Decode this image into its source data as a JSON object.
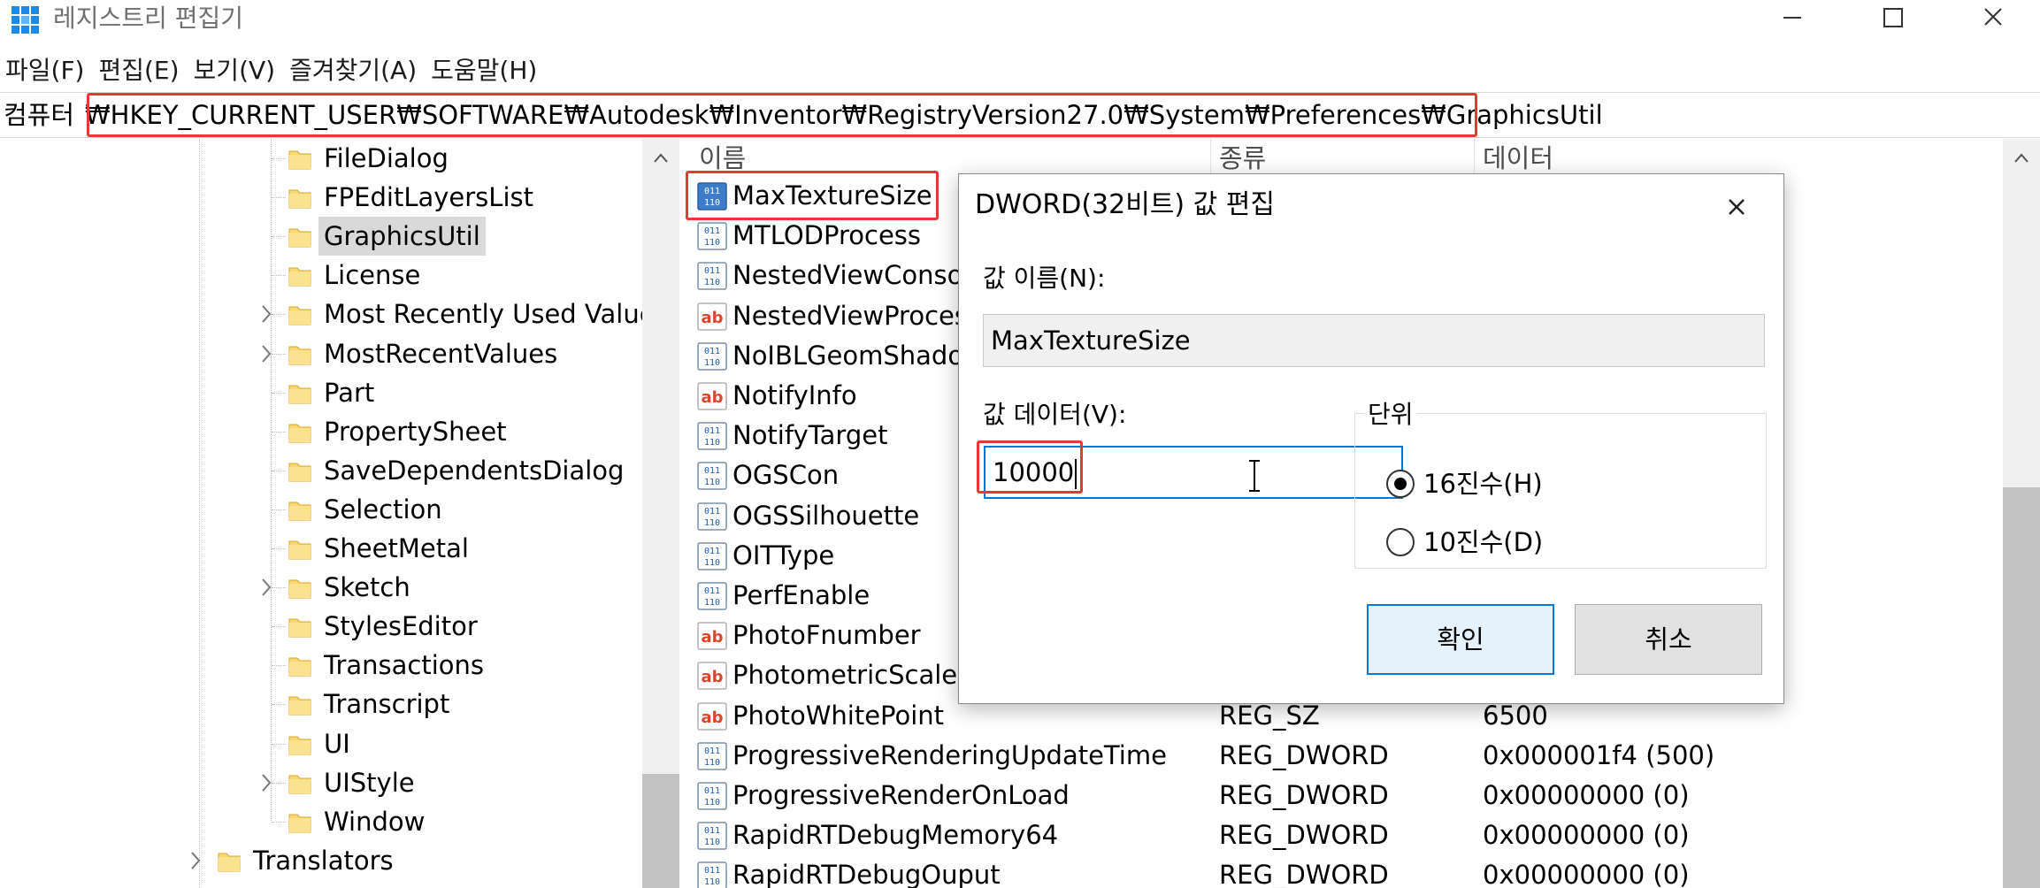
{
  "window": {
    "title": "레지스트리 편집기"
  },
  "menu": [
    {
      "label": "파일(F)"
    },
    {
      "label": "편집(E)"
    },
    {
      "label": "보기(V)"
    },
    {
      "label": "즐겨찾기(A)"
    },
    {
      "label": "도움말(H)"
    }
  ],
  "address": {
    "prefix": "컴퓨터",
    "path": "₩HKEY_CURRENT_USER₩SOFTWARE₩Autodesk₩Inventor₩RegistryVersion27.0₩System₩Preferences₩GraphicsUtil"
  },
  "tree": {
    "items": [
      {
        "label": "FileDialog",
        "expandable": false,
        "selected": false
      },
      {
        "label": "FPEditLayersList",
        "expandable": false,
        "selected": false
      },
      {
        "label": "GraphicsUtil",
        "expandable": false,
        "selected": true
      },
      {
        "label": "License",
        "expandable": false,
        "selected": false
      },
      {
        "label": "Most Recently Used Value",
        "expandable": true,
        "selected": false
      },
      {
        "label": "MostRecentValues",
        "expandable": true,
        "selected": false
      },
      {
        "label": "Part",
        "expandable": false,
        "selected": false
      },
      {
        "label": "PropertySheet",
        "expandable": false,
        "selected": false
      },
      {
        "label": "SaveDependentsDialog",
        "expandable": false,
        "selected": false
      },
      {
        "label": "Selection",
        "expandable": false,
        "selected": false
      },
      {
        "label": "SheetMetal",
        "expandable": false,
        "selected": false
      },
      {
        "label": "Sketch",
        "expandable": true,
        "selected": false
      },
      {
        "label": "StylesEditor",
        "expandable": false,
        "selected": false
      },
      {
        "label": "Transactions",
        "expandable": false,
        "selected": false
      },
      {
        "label": "Transcript",
        "expandable": false,
        "selected": false
      },
      {
        "label": "UI",
        "expandable": false,
        "selected": false
      },
      {
        "label": "UIStyle",
        "expandable": true,
        "selected": false
      },
      {
        "label": "Window",
        "expandable": false,
        "selected": false
      }
    ],
    "translators": {
      "label": "Translators",
      "expandable": true
    }
  },
  "list": {
    "headers": {
      "name": "이름",
      "type": "종류",
      "data": "데이터"
    },
    "rows": [
      {
        "icon": "binary-value-icon",
        "name": "MaxTextureSize",
        "type": "",
        "data": ""
      },
      {
        "icon": "binary-value-icon",
        "name": "MTLODProcess",
        "type": "",
        "data": ""
      },
      {
        "icon": "binary-value-icon",
        "name": "NestedViewConsoli",
        "type": "",
        "data": ""
      },
      {
        "icon": "string-value-icon",
        "name": "NestedViewProcess",
        "type": "",
        "data": ""
      },
      {
        "icon": "binary-value-icon",
        "name": "NoIBLGeomShadov",
        "type": "",
        "data": ""
      },
      {
        "icon": "string-value-icon",
        "name": "NotifyInfo",
        "type": "",
        "data": ""
      },
      {
        "icon": "binary-value-icon",
        "name": "NotifyTarget",
        "type": "",
        "data": ""
      },
      {
        "icon": "binary-value-icon",
        "name": "OGSCon",
        "type": "",
        "data": ""
      },
      {
        "icon": "binary-value-icon",
        "name": "OGSSilhouette",
        "type": "",
        "data": ""
      },
      {
        "icon": "binary-value-icon",
        "name": "OITType",
        "type": "",
        "data": ""
      },
      {
        "icon": "binary-value-icon",
        "name": "PerfEnable",
        "type": "",
        "data": ""
      },
      {
        "icon": "string-value-icon",
        "name": "PhotoFnumber",
        "type": "",
        "data": ""
      },
      {
        "icon": "string-value-icon",
        "name": "PhotometricScale",
        "type": "",
        "data": ""
      },
      {
        "icon": "string-value-icon",
        "name": "PhotoWhitePoint",
        "type": "REG_SZ",
        "data": "6500"
      },
      {
        "icon": "binary-value-icon",
        "name": "ProgressiveRenderingUpdateTime",
        "type": "REG_DWORD",
        "data": "0x000001f4 (500)"
      },
      {
        "icon": "binary-value-icon",
        "name": "ProgressiveRenderOnLoad",
        "type": "REG_DWORD",
        "data": "0x00000000 (0)"
      },
      {
        "icon": "binary-value-icon",
        "name": "RapidRTDebugMemory64",
        "type": "REG_DWORD",
        "data": "0x00000000 (0)"
      },
      {
        "icon": "binary-value-icon",
        "name": "RapidRTDebugOuput",
        "type": "REG_DWORD",
        "data": "0x00000000 (0)"
      }
    ]
  },
  "dialog": {
    "title": "DWORD(32비트) 값 편집",
    "name_label": "값 이름(N):",
    "name_value": "MaxTextureSize",
    "data_label": "값 데이터(V):",
    "data_value": "10000",
    "base_group_label": "단위",
    "base_hex_label": "16진수(H)",
    "base_dec_label": "10진수(D)",
    "base_selected": "hex",
    "ok_label": "확인",
    "cancel_label": "취소"
  },
  "colors": {
    "highlight_red": "#e53935",
    "focus_blue": "#0078d7",
    "folder_yellow": "#f8d775",
    "selection_gray": "#d9d9d9"
  }
}
